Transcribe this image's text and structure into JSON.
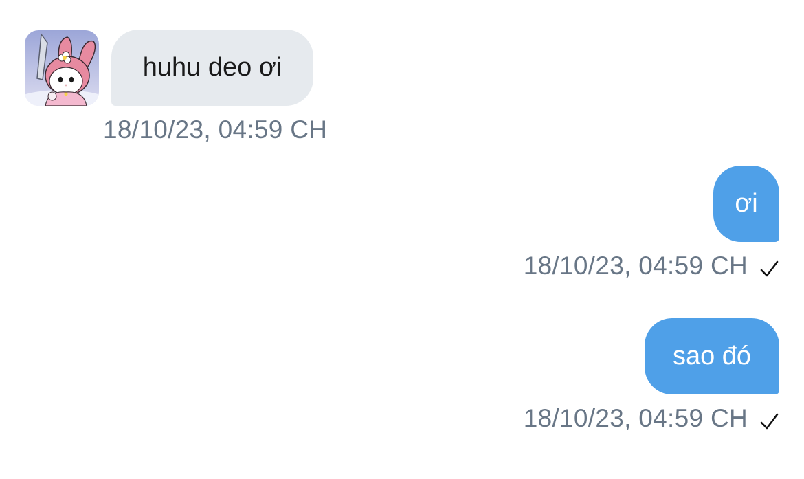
{
  "messages": [
    {
      "direction": "incoming",
      "text": "huhu deo ơi",
      "timestamp": "18/10/23, 04:59 CH",
      "avatar_icon": "avatar-icon"
    },
    {
      "direction": "outgoing",
      "text": "ơi",
      "timestamp": "18/10/23, 04:59 CH",
      "status_icon": "checkmark-icon"
    },
    {
      "direction": "outgoing",
      "text": "sao đó",
      "timestamp": "18/10/23, 04:59 CH",
      "status_icon": "checkmark-icon"
    }
  ],
  "colors": {
    "incoming_bubble": "#e6eaee",
    "outgoing_bubble": "#4fa0e8",
    "timestamp_text": "#687686",
    "incoming_text": "#1a1a1a",
    "outgoing_text": "#ffffff"
  }
}
